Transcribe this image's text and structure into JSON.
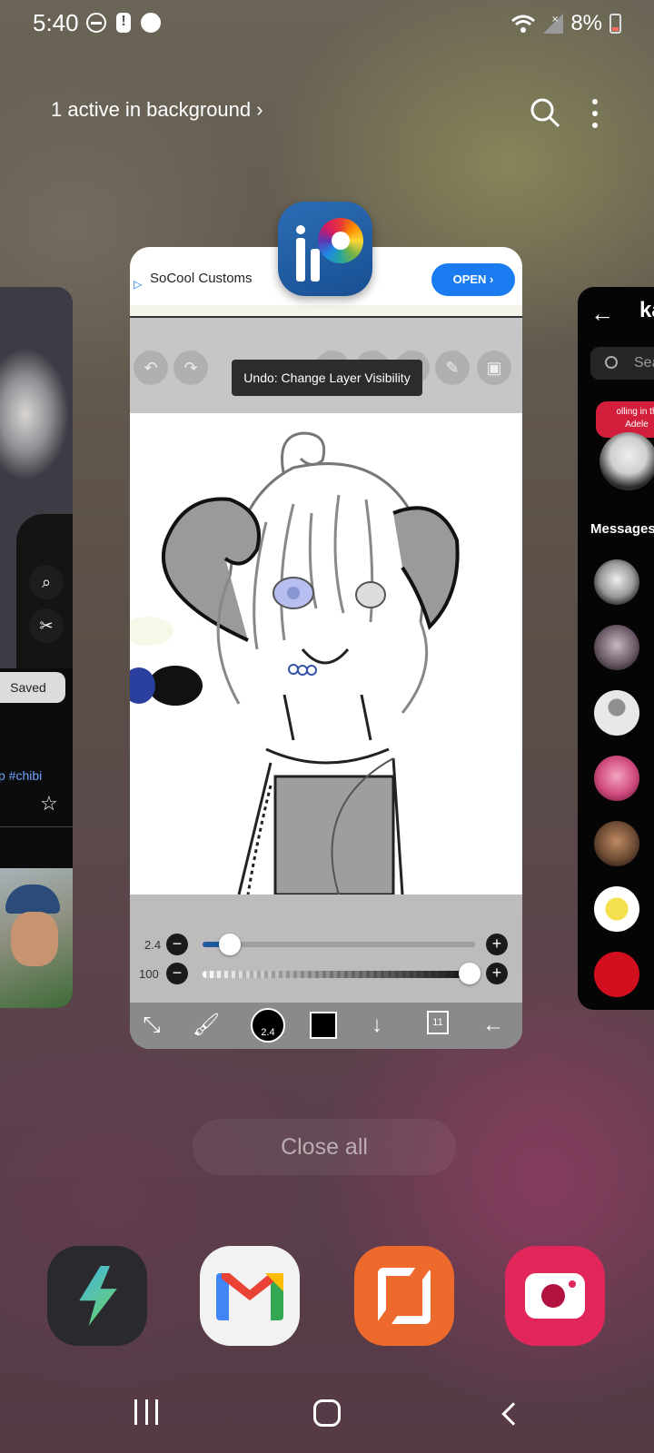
{
  "status_bar": {
    "time": "5:40",
    "battery": "8%"
  },
  "recents_header": {
    "active_background": "1 active in background",
    "chevron": "›"
  },
  "left_app_card": {
    "saved_label": "Saved",
    "hashtag": "p #chibi"
  },
  "main_app_card": {
    "ad": {
      "advertiser": "SoCool Customs",
      "cta": "OPEN ›"
    },
    "toast": "Undo: Change Layer Visibility",
    "brush_size": "2.4",
    "opacity": "100",
    "brush_size_fraction": 0.1,
    "opacity_fraction": 1.0,
    "color_brush_size": "2.4",
    "layer_count": "11"
  },
  "right_app_card": {
    "title": "ka",
    "search_placeholder": "Sea",
    "note_line1": "olling in th",
    "note_line2": "Adele",
    "messages_header": "Messages"
  },
  "close_all_label": "Close all",
  "dock": {
    "apps": [
      "bolt-app",
      "gmail",
      "zoho-app",
      "screen-recorder"
    ]
  },
  "colors": {
    "ad_button": "#1a7cf0",
    "toast_bg": "#2c2c2c",
    "note_red": "#d21f3c"
  }
}
